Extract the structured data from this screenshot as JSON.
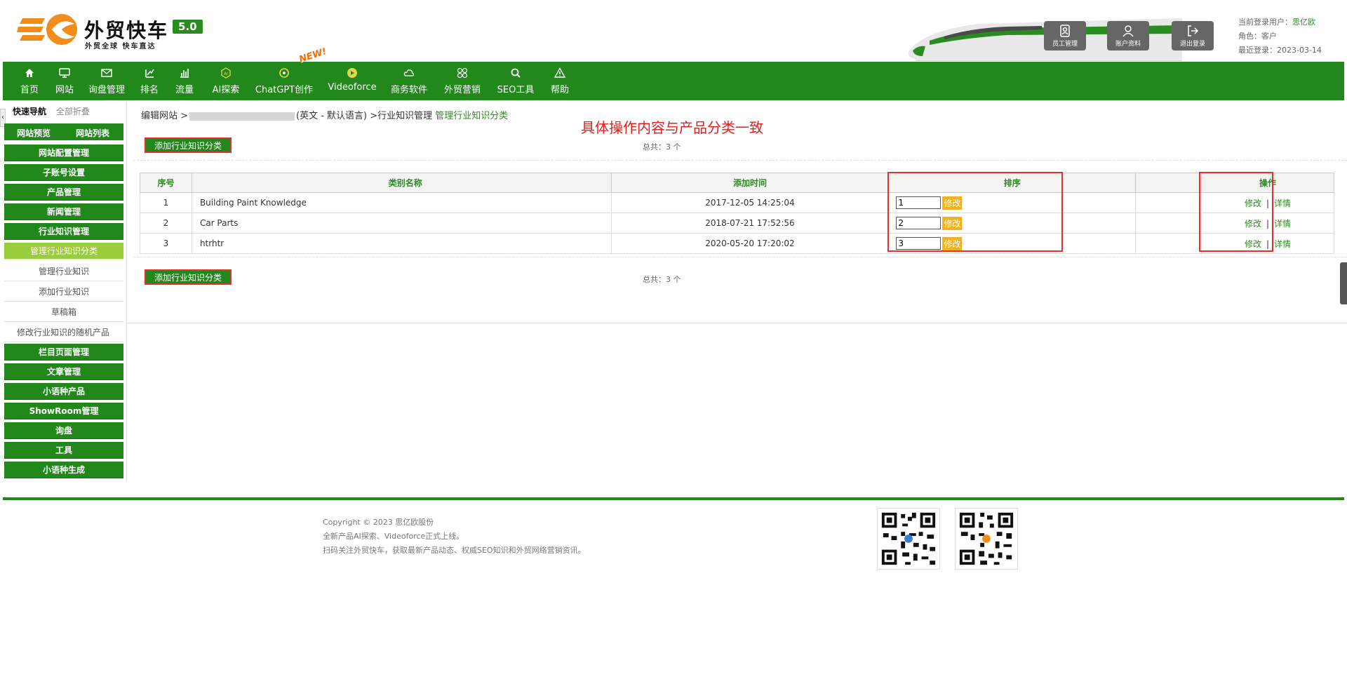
{
  "brand": {
    "title": "外贸快车",
    "version": "5.0",
    "slogan": "外贸全球 快车直达"
  },
  "header": {
    "buttons": {
      "staff": "员工管理",
      "account": "账户资料",
      "logout": "退出登录"
    },
    "user": {
      "label": "当前登录用户：",
      "name": "思亿欧",
      "role_label": "角色：",
      "role": "客户",
      "last_login_label": "最近登录：",
      "last_login": "2023-03-14"
    }
  },
  "topnav": {
    "items": [
      {
        "label": "首页",
        "icon": "home-icon"
      },
      {
        "label": "网站",
        "icon": "monitor-icon"
      },
      {
        "label": "询盘管理",
        "icon": "mail-icon"
      },
      {
        "label": "排名",
        "icon": "rank-icon"
      },
      {
        "label": "流量",
        "icon": "bar-chart-icon"
      },
      {
        "label": "AI探索",
        "icon": "ai-icon"
      },
      {
        "label": "ChatGPT创作",
        "icon": "chatgpt-icon"
      },
      {
        "label": "Videoforce",
        "icon": "video-icon"
      },
      {
        "label": "商务软件",
        "icon": "cloud-icon"
      },
      {
        "label": "外贸营销",
        "icon": "grid-circles-icon"
      },
      {
        "label": "SEO工具",
        "icon": "search-icon"
      },
      {
        "label": "帮助",
        "icon": "warning-icon"
      }
    ],
    "new_badge": "NEW!"
  },
  "sidebar": {
    "tab_active": "快速导航",
    "tab_collapse": "全部折叠",
    "preview": "网站预览",
    "list": "网站列表",
    "groups_top": [
      "网站配置管理",
      "子账号设置",
      "产品管理",
      "新闻管理",
      "行业知识管理"
    ],
    "subs": [
      "管理行业知识分类",
      "管理行业知识",
      "添加行业知识",
      "草稿箱",
      "修改行业知识的随机产品"
    ],
    "groups_bottom": [
      "栏目页面管理",
      "文章管理",
      "小语种产品",
      "ShowRoom管理",
      "询盘",
      "工具",
      "小语种生成"
    ]
  },
  "breadcrumb": {
    "prefix": "编辑网站 >",
    "lang": "(英文 - 默认语言) >行业知识管理",
    "current": "管理行业知识分类"
  },
  "annotation": "具体操作内容与产品分类一致",
  "actions": {
    "add_label": "添加行业知识分类",
    "total": "总共：3 个"
  },
  "table": {
    "headers": {
      "idx": "序号",
      "name": "类别名称",
      "time": "添加时间",
      "order": "排序",
      "ops": "操作"
    },
    "modify_btn": "修改",
    "op_edit": "修改",
    "op_sep": "|",
    "op_detail": "详情",
    "rows": [
      {
        "idx": "1",
        "name": "Building Paint Knowledge",
        "time": "2017-12-05 14:25:04",
        "order": "1"
      },
      {
        "idx": "2",
        "name": "Car Parts",
        "time": "2018-07-21 17:52:56",
        "order": "2"
      },
      {
        "idx": "3",
        "name": "htrhtr",
        "time": "2020-05-20 17:20:02",
        "order": "3"
      }
    ]
  },
  "footer": {
    "copyright": "Copyright © 2023 思亿欧股份",
    "news": "全新产品AI探索、Videoforce正式上线。",
    "scan": "扫码关注外贸快车，获取最新产品动态、权威SEO知识和外贸网络营销资讯。"
  },
  "colors": {
    "primary": "#23881c",
    "accent_light": "#9acd3c",
    "alert_red": "#e53030",
    "modify_yellow": "#f2b21b"
  }
}
